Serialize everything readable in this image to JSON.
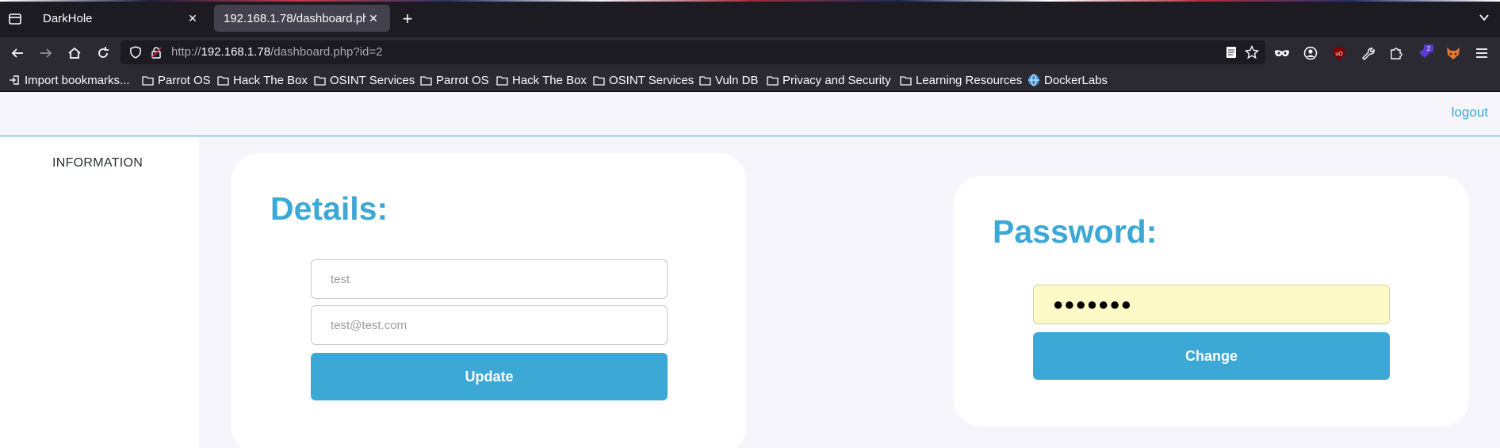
{
  "browser": {
    "tabs": [
      {
        "title": "DarkHole",
        "active": false
      },
      {
        "title": "192.168.1.78/dashboard.php?id=2",
        "active": true
      }
    ],
    "url": {
      "prefix": "http://",
      "host": "192.168.1.78",
      "path": "/dashboard.php?id=2"
    },
    "extension_badge": "2",
    "bookmarks": [
      {
        "label": "Import bookmarks...",
        "icon": "import-icon"
      },
      {
        "label": "Parrot OS",
        "icon": "folder-icon"
      },
      {
        "label": "Hack The Box",
        "icon": "folder-icon"
      },
      {
        "label": "OSINT Services",
        "icon": "folder-icon"
      },
      {
        "label": "Parrot OS",
        "icon": "folder-icon"
      },
      {
        "label": "Hack The Box",
        "icon": "folder-icon"
      },
      {
        "label": "OSINT Services",
        "icon": "folder-icon"
      },
      {
        "label": "Vuln DB",
        "icon": "folder-icon"
      },
      {
        "label": "Privacy and Security",
        "icon": "folder-icon"
      },
      {
        "label": "Learning Resources",
        "icon": "folder-icon"
      },
      {
        "label": "DockerLabs",
        "icon": "globe-icon"
      }
    ]
  },
  "page": {
    "logout_label": "logout",
    "sidebar_label": "INFORMATION",
    "details": {
      "title": "Details:",
      "username_placeholder": "test",
      "email_placeholder": "test@test.com",
      "update_label": "Update"
    },
    "password": {
      "title": "Password:",
      "value": "●●●●●●●",
      "change_label": "Change"
    }
  },
  "colors": {
    "accent": "#3ba8d6",
    "page_bg": "#f6f5fc",
    "autofill_bg": "#fdfac7",
    "chrome_dark": "#1c1b22",
    "chrome_toolbar": "#2b2a33"
  }
}
